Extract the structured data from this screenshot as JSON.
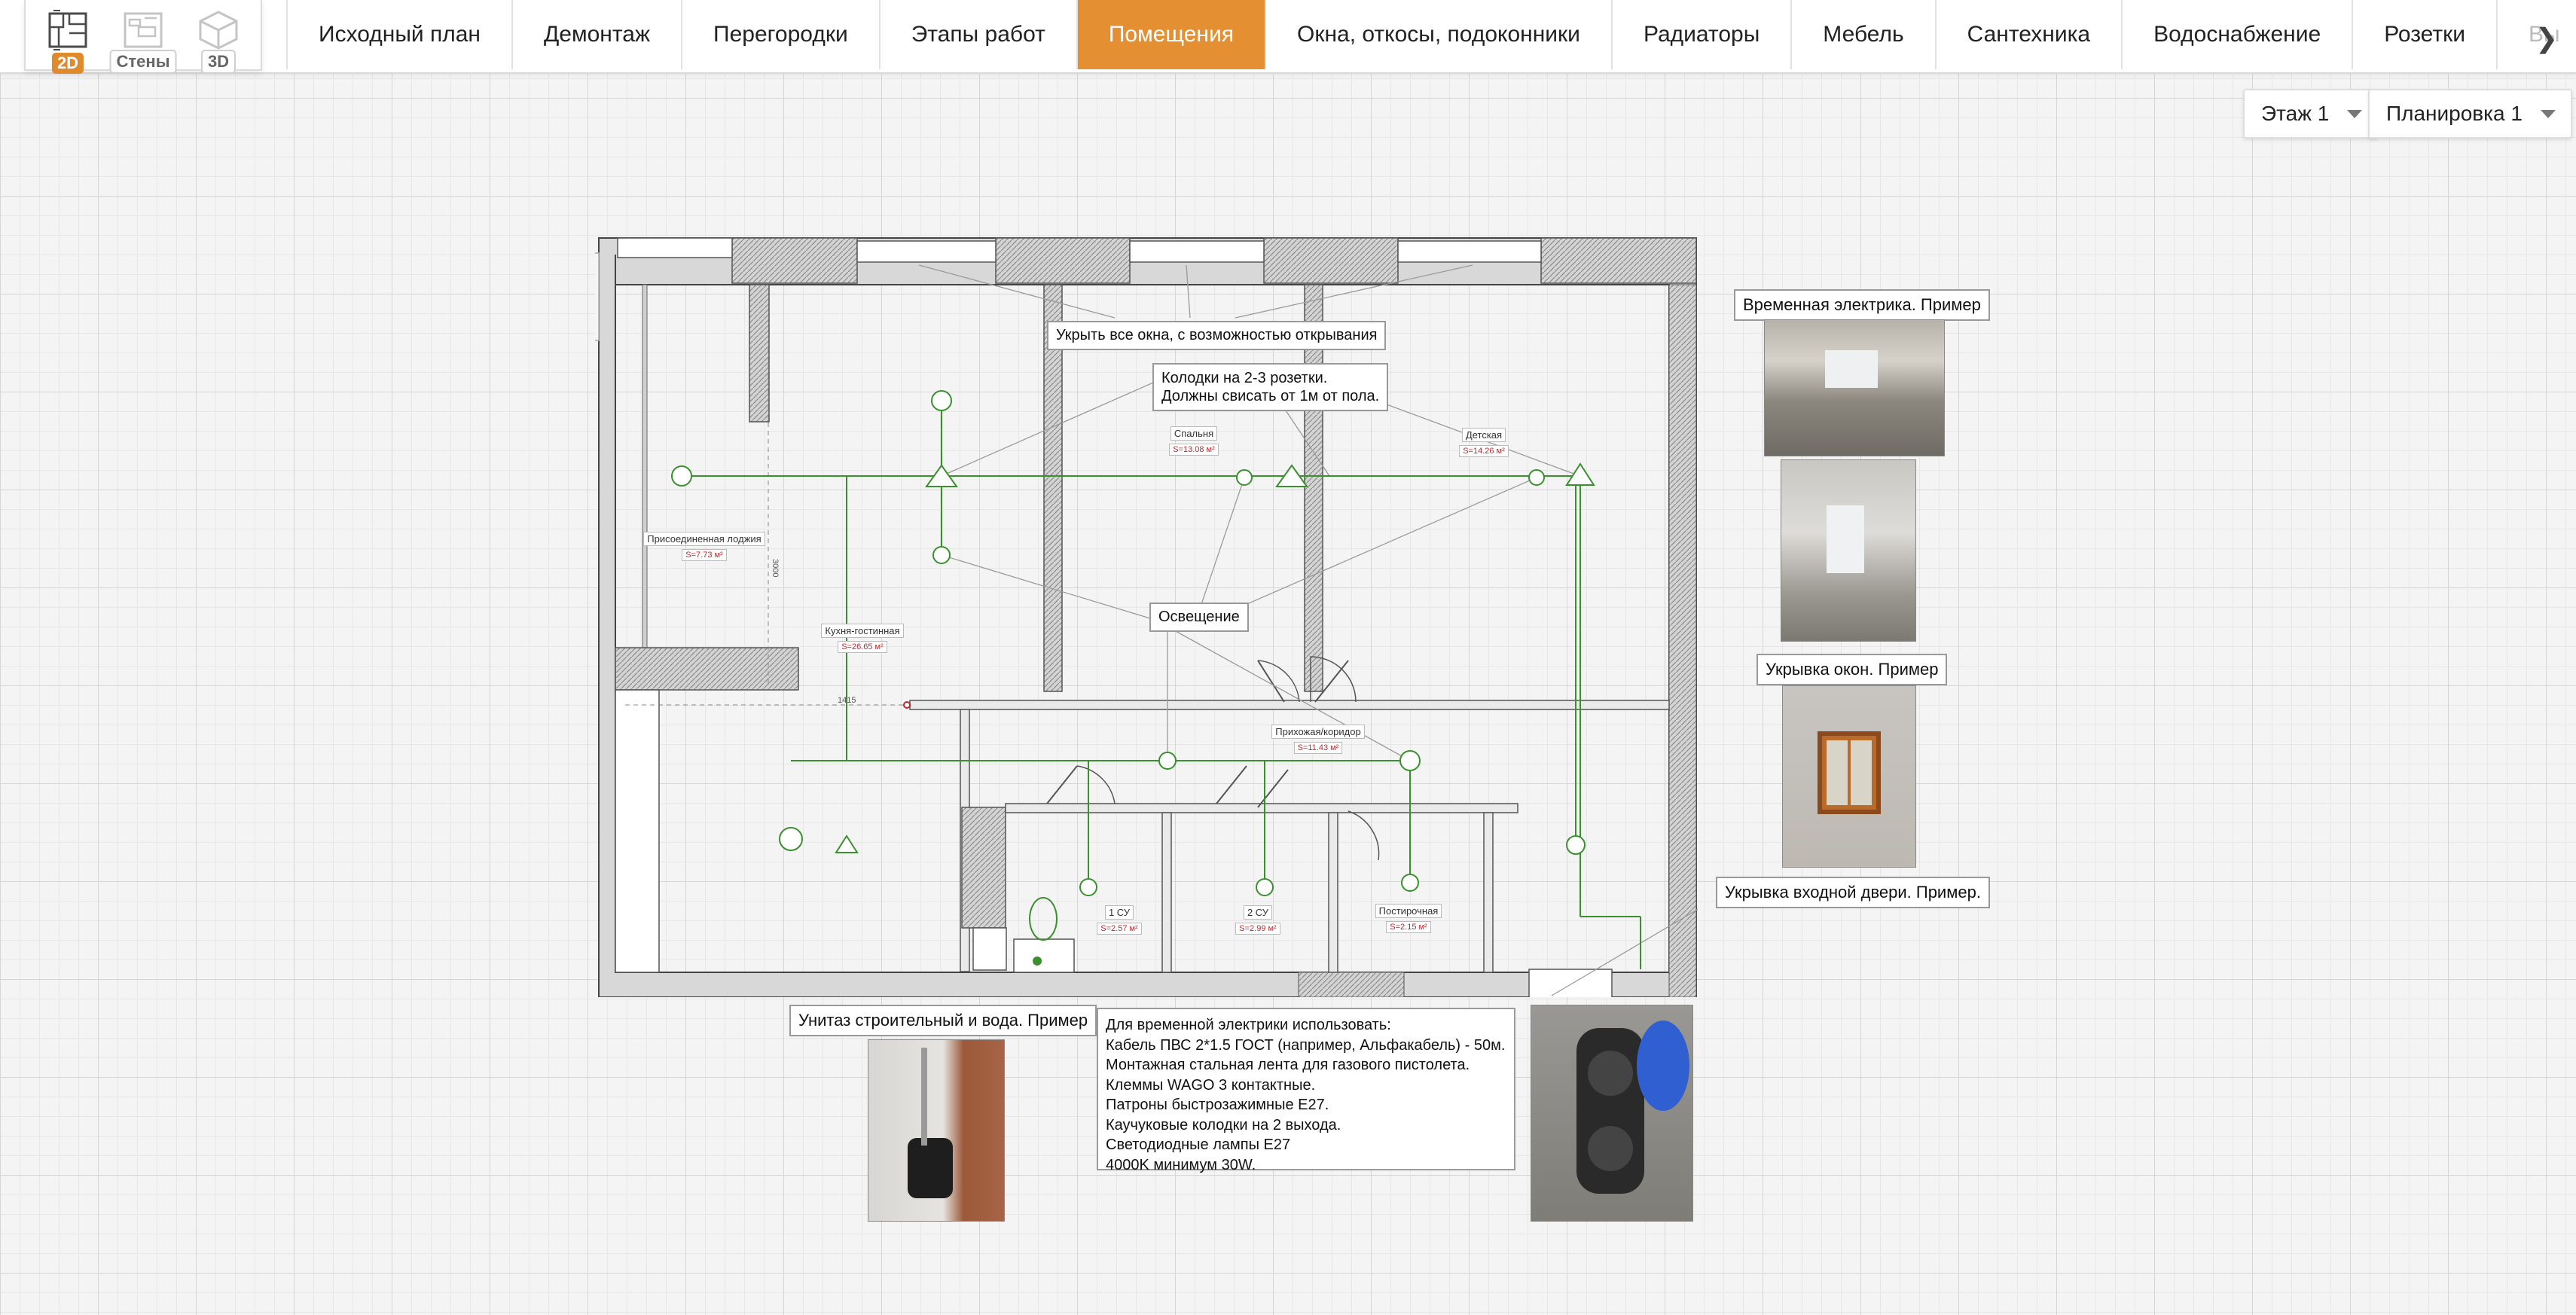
{
  "view_modes": [
    {
      "label": "2D",
      "active": true
    },
    {
      "label": "Стены",
      "active": false
    },
    {
      "label": "3D",
      "active": false
    }
  ],
  "tabs": [
    {
      "label": "Исходный план",
      "active": false
    },
    {
      "label": "Демонтаж",
      "active": false
    },
    {
      "label": "Перегородки",
      "active": false
    },
    {
      "label": "Этапы работ",
      "active": false
    },
    {
      "label": "Помещения",
      "active": true
    },
    {
      "label": "Окна, откосы, подоконники",
      "active": false
    },
    {
      "label": "Радиаторы",
      "active": false
    },
    {
      "label": "Мебель",
      "active": false
    },
    {
      "label": "Сантехника",
      "active": false
    },
    {
      "label": "Водоснабжение",
      "active": false
    },
    {
      "label": "Розетки",
      "active": false
    },
    {
      "label": "Вы",
      "active": false
    }
  ],
  "floor_select": {
    "value": "Этаж 1"
  },
  "layout_select": {
    "value": "Планировка 1"
  },
  "accent_color": "#e58f33",
  "wiring_color": "#3a8f2e",
  "rooms": [
    {
      "name": "Присоединенная лоджия",
      "area": "S=7.73 м²"
    },
    {
      "name": "Кухня-гостинная",
      "area": "S=26.65 м²"
    },
    {
      "name": "Спальня",
      "area": "S=13.08 м²"
    },
    {
      "name": "Детская",
      "area": "S=14.26 м²"
    },
    {
      "name": "Прихожая/коридор",
      "area": "S=11.43 м²"
    },
    {
      "name": "1 СУ",
      "area": "S=2.57 м²"
    },
    {
      "name": "2 СУ",
      "area": "S=2.99 м²"
    },
    {
      "name": "Постирочная",
      "area": "S=2.15 м²"
    }
  ],
  "dimensions": {
    "vertical": "3000",
    "horizontal": "1415"
  },
  "annotations": {
    "cover_windows": "Укрыть все окна, с возможностью открывания",
    "sockets_line1": "Колодки на 2-3 розетки.",
    "sockets_line2": "Должны свисать от 1м от пола.",
    "lighting": "Освещение",
    "temp_electric": "Временная электрика. Пример",
    "window_cover": "Укрывка окон. Пример",
    "door_cover": "Укрывка входной двери. Пример.",
    "toilet_water": "Унитаз строительный и вода. Пример"
  },
  "materials_note": {
    "lines": [
      "Для временной электрики использовать:",
      "Кабель ПВС 2*1.5 ГОСТ (например, Альфакабель) - 50м.",
      "Монтажная стальная лента для газового пистолета.",
      "Клеммы WAGO 3 контактные.",
      "Патроны быстрозажимные Е27.",
      "Каучуковые колодки на 2 выхода.",
      "Светодиодные лампы Е27",
      "4000K минимум 30W."
    ]
  }
}
